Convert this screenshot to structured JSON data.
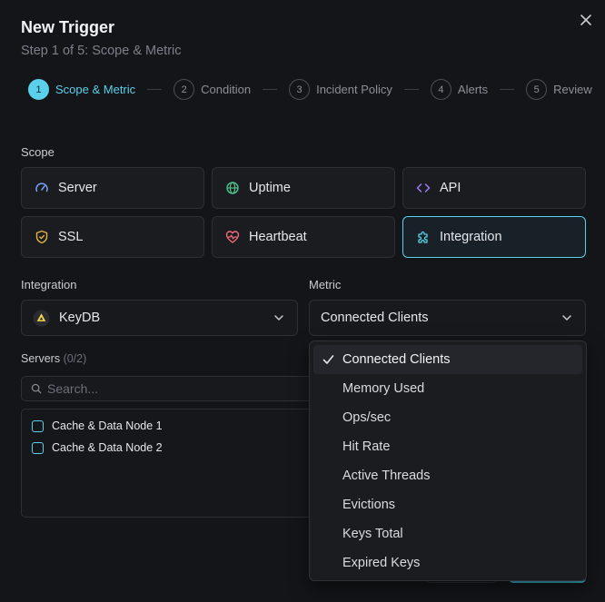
{
  "modal": {
    "title": "New Trigger",
    "subtitle": "Step 1 of 5: Scope & Metric"
  },
  "steps": [
    {
      "num": "1",
      "label": "Scope & Metric",
      "active": true
    },
    {
      "num": "2",
      "label": "Condition"
    },
    {
      "num": "3",
      "label": "Incident Policy"
    },
    {
      "num": "4",
      "label": "Alerts"
    },
    {
      "num": "5",
      "label": "Review"
    }
  ],
  "scope": {
    "label": "Scope",
    "options": [
      {
        "label": "Server",
        "icon": "gauge-icon"
      },
      {
        "label": "Uptime",
        "icon": "globe-icon"
      },
      {
        "label": "API",
        "icon": "code-icon"
      },
      {
        "label": "SSL",
        "icon": "shield-icon"
      },
      {
        "label": "Heartbeat",
        "icon": "heart-pulse-icon"
      },
      {
        "label": "Integration",
        "icon": "puzzle-icon",
        "selected": true
      }
    ]
  },
  "integration": {
    "label": "Integration",
    "value": "KeyDB"
  },
  "metric": {
    "label": "Metric",
    "value": "Connected Clients",
    "options": [
      "Connected Clients",
      "Memory Used",
      "Ops/sec",
      "Hit Rate",
      "Active Threads",
      "Evictions",
      "Keys Total",
      "Expired Keys"
    ]
  },
  "servers": {
    "label": "Servers",
    "count": "(0/2)",
    "search_placeholder": "Search...",
    "items": [
      "Cache & Data Node 1",
      "Cache & Data Node 2"
    ]
  },
  "colors": {
    "accent": "#5ad0ea",
    "background": "#141518",
    "border": "#2c2f35"
  }
}
